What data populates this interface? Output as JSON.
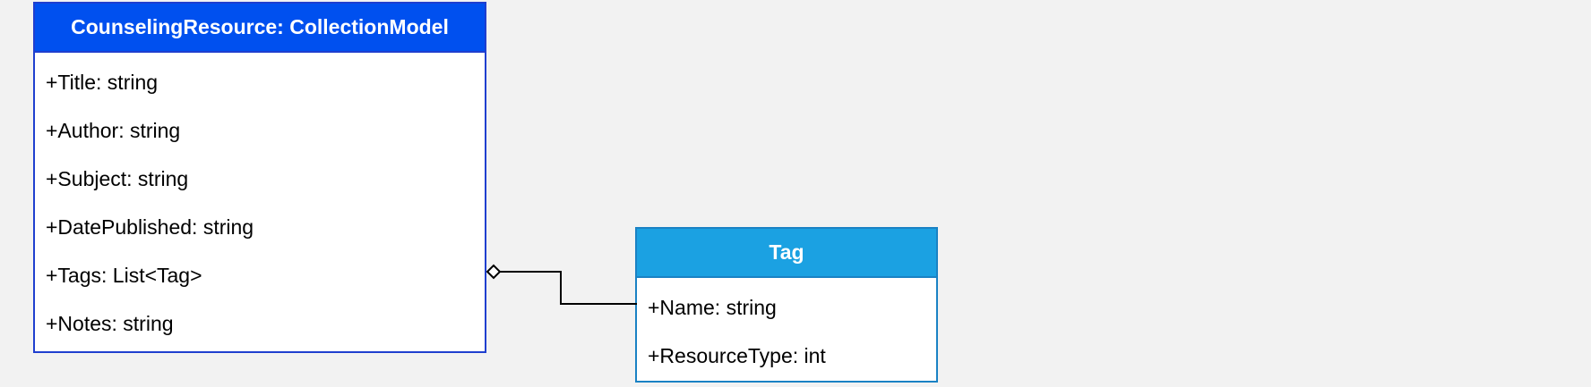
{
  "classes": {
    "main": {
      "title": "CounselingResource: CollectionModel",
      "header_color": "#0050ef",
      "border_color": "#1f3fcf",
      "attributes": [
        "+Title: string",
        "+Author: string",
        "+Subject: string",
        "+DatePublished: string",
        "+Tags: List<Tag>",
        "+Notes: string"
      ]
    },
    "tag": {
      "title": "Tag",
      "header_color": "#1ba1e2",
      "border_color": "#1a82c4",
      "attributes": [
        "+Name: string",
        "+ResourceType: int"
      ]
    }
  },
  "relationship": {
    "type": "aggregation",
    "from": "CounselingResource: CollectionModel",
    "to": "Tag"
  },
  "background_color": "#f2f2f2"
}
